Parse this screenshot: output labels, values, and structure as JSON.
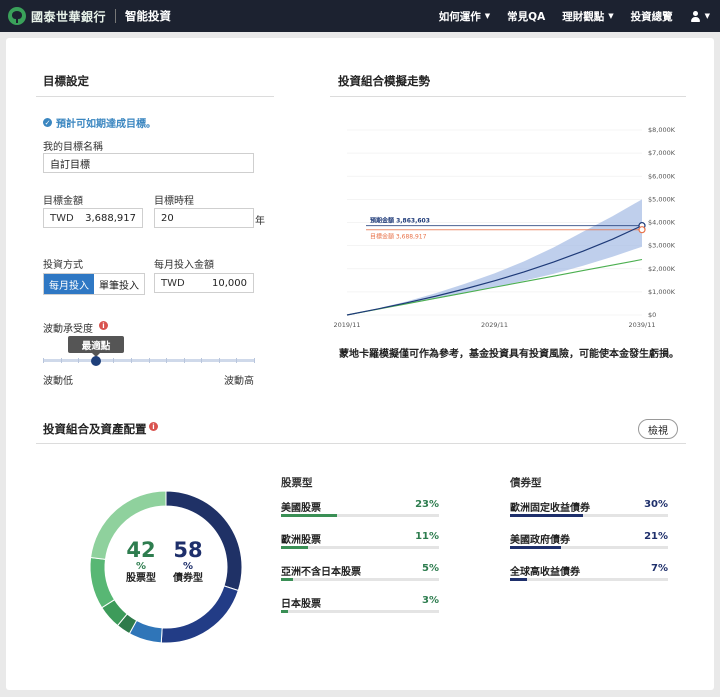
{
  "header": {
    "brand": "國泰世華銀行",
    "product": "智能投資",
    "nav": [
      {
        "label": "如何運作",
        "dropdown": true
      },
      {
        "label": "常見QA",
        "dropdown": false
      },
      {
        "label": "理財觀點",
        "dropdown": true
      },
      {
        "label": "投資總覽",
        "dropdown": false
      }
    ]
  },
  "goal": {
    "section_title": "目標設定",
    "status": "預計可如期達成目標。",
    "name_label": "我的目標名稱",
    "name_value": "自訂目標",
    "amount_label": "目標金額",
    "amount_currency": "TWD",
    "amount_value": "3,688,917",
    "term_label": "目標時程",
    "term_value": "20",
    "term_unit": "年",
    "method_label": "投資方式",
    "method_options": [
      "每月投入",
      "單筆投入"
    ],
    "method_selected": "每月投入",
    "monthly_label": "每月投入金額",
    "monthly_currency": "TWD",
    "monthly_value": "10,000",
    "risk_label": "波動承受度",
    "risk_tip": "最適點",
    "risk_low": "波動低",
    "risk_high": "波動高",
    "risk_level": 0.25
  },
  "simulation": {
    "section_title": "投資組合模擬走勢",
    "expected_label": "預期金額 3,863,603",
    "target_label": "目標金額 3,688,917",
    "note": "蒙地卡羅模擬僅可作為參考，基金投資具有投資風險，可能使本金發生虧損。",
    "colors": {
      "expected": "#1e3a78",
      "target": "#e8734a",
      "band": "#a9bfe6",
      "invested": "#4caf50"
    }
  },
  "chart_data": {
    "type": "line",
    "x": [
      "2019/11",
      "2029/11",
      "2039/11"
    ],
    "xticks": [
      "2019/11",
      "2029/11",
      "2039/11"
    ],
    "yticks": [
      "$0",
      "$1,000K",
      "$2,000K",
      "$3,000K",
      "$4,000K",
      "$5,000K",
      "$6,000K",
      "$7,000K",
      "$8,000K"
    ],
    "ylim": [
      0,
      8000
    ],
    "years": [
      0,
      2,
      4,
      6,
      8,
      10,
      12,
      14,
      16,
      18,
      20
    ],
    "series": [
      {
        "values": [
          0,
          250,
          520,
          810,
          1130,
          1480,
          1860,
          2290,
          2760,
          3280,
          3864
        ]
      },
      {
        "values": [
          0,
          240,
          480,
          720,
          960,
          1200,
          1440,
          1680,
          1920,
          2160,
          2400
        ]
      }
    ],
    "band_upper": [
      0,
      270,
      580,
      940,
      1350,
      1800,
      2320,
      2920,
      3600,
      4270,
      5000
    ],
    "band_lower": [
      0,
      235,
      470,
      700,
      940,
      1200,
      1480,
      1780,
      2130,
      2520,
      2950
    ],
    "expected_value": 3864,
    "target_value": 3689
  },
  "allocation": {
    "section_title": "投資組合及資產配置",
    "view_button": "檢視",
    "stock_pct": "42",
    "bond_pct": "58",
    "pct_sign": "%",
    "stock_label": "股票型",
    "bond_label": "債券型",
    "stock_group": "股票型",
    "bond_group": "債券型",
    "stocks": [
      {
        "name": "美國股票",
        "pct": "23%",
        "value": 23
      },
      {
        "name": "歐洲股票",
        "pct": "11%",
        "value": 11
      },
      {
        "name": "亞洲不含日本股票",
        "pct": "5%",
        "value": 5
      },
      {
        "name": "日本股票",
        "pct": "3%",
        "value": 3
      }
    ],
    "bonds": [
      {
        "name": "歐洲固定收益債券",
        "pct": "30%",
        "value": 30
      },
      {
        "name": "美國政府債券",
        "pct": "21%",
        "value": 21
      },
      {
        "name": "全球高收益債券",
        "pct": "7%",
        "value": 7
      }
    ],
    "colors": {
      "stock_text": "#2e7d4f",
      "bond_text": "#1e2f6b",
      "stock_bar": "#3a8f55",
      "bond_bar": "#1e2f6b",
      "donut": [
        "#1f3166",
        "#223c86",
        "#2f75b8",
        "#2e7a4a",
        "#3d9b5a",
        "#58b774",
        "#8fd19d"
      ]
    }
  }
}
